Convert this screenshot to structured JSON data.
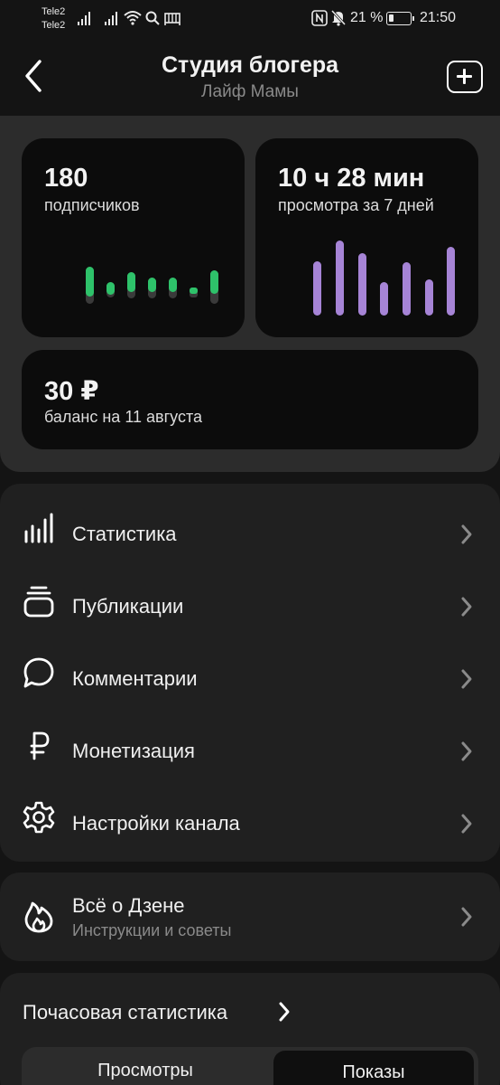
{
  "status_bar": {
    "carrier_1": "Tele2",
    "carrier_2": "Tele2",
    "battery_text": "21 %",
    "time": "21:50"
  },
  "header": {
    "title": "Студия блогера",
    "subtitle": "Лайф Мамы"
  },
  "stats": {
    "subscribers": {
      "value": "180",
      "label": "подписчиков",
      "bar_color": "#2ec26a",
      "bar_track_color": "#3a3a3a"
    },
    "views": {
      "value": "10 ч 28 мин",
      "label": "просмотра за 7 дней",
      "bar_color": "#a684d6"
    },
    "balance": {
      "value": "30 ₽",
      "label": "баланс на 11 августа"
    }
  },
  "menu": {
    "items": [
      {
        "label": "Статистика",
        "icon": "stats-bars-icon"
      },
      {
        "label": "Публикации",
        "icon": "publications-stack-icon"
      },
      {
        "label": "Комментарии",
        "icon": "comment-bubble-icon"
      },
      {
        "label": "Монетизация",
        "icon": "ruble-icon"
      },
      {
        "label": "Настройки канала",
        "icon": "gear-icon"
      }
    ]
  },
  "zen": {
    "title": "Всё о Дзене",
    "subtitle": "Инструкции и советы",
    "icon": "flame-icon"
  },
  "hourly": {
    "title": "Почасовая статистика",
    "tabs": [
      "Просмотры",
      "Показы"
    ],
    "selected_tab": "Показы"
  },
  "colors": {
    "background": "#141414",
    "panel": "#202020",
    "stats_panel": "#2c2c2c",
    "card": "#0c0c0c"
  }
}
